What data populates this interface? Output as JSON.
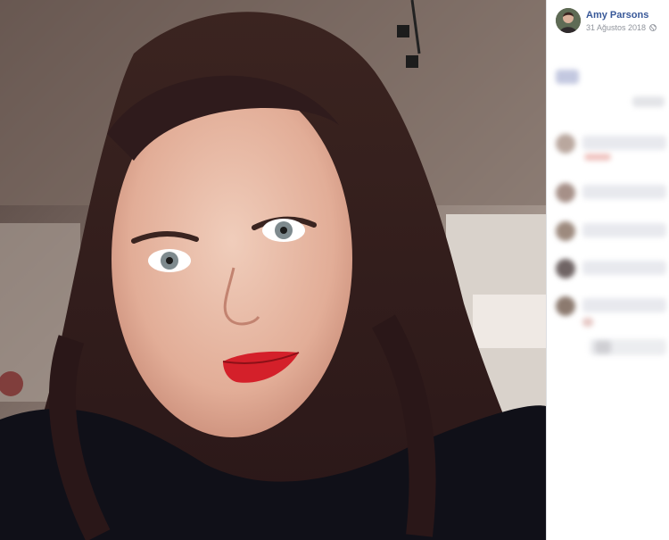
{
  "post": {
    "author": "Amy Parsons",
    "date": "31 Ağustos 2018",
    "privacy_icon": "globe-icon"
  },
  "photo": {
    "subject": "selfie-photo"
  },
  "comments_area": {
    "state": "blurred"
  },
  "colors": {
    "link": "#385898",
    "meta_text": "#90949c",
    "divider": "#dddfe2"
  }
}
